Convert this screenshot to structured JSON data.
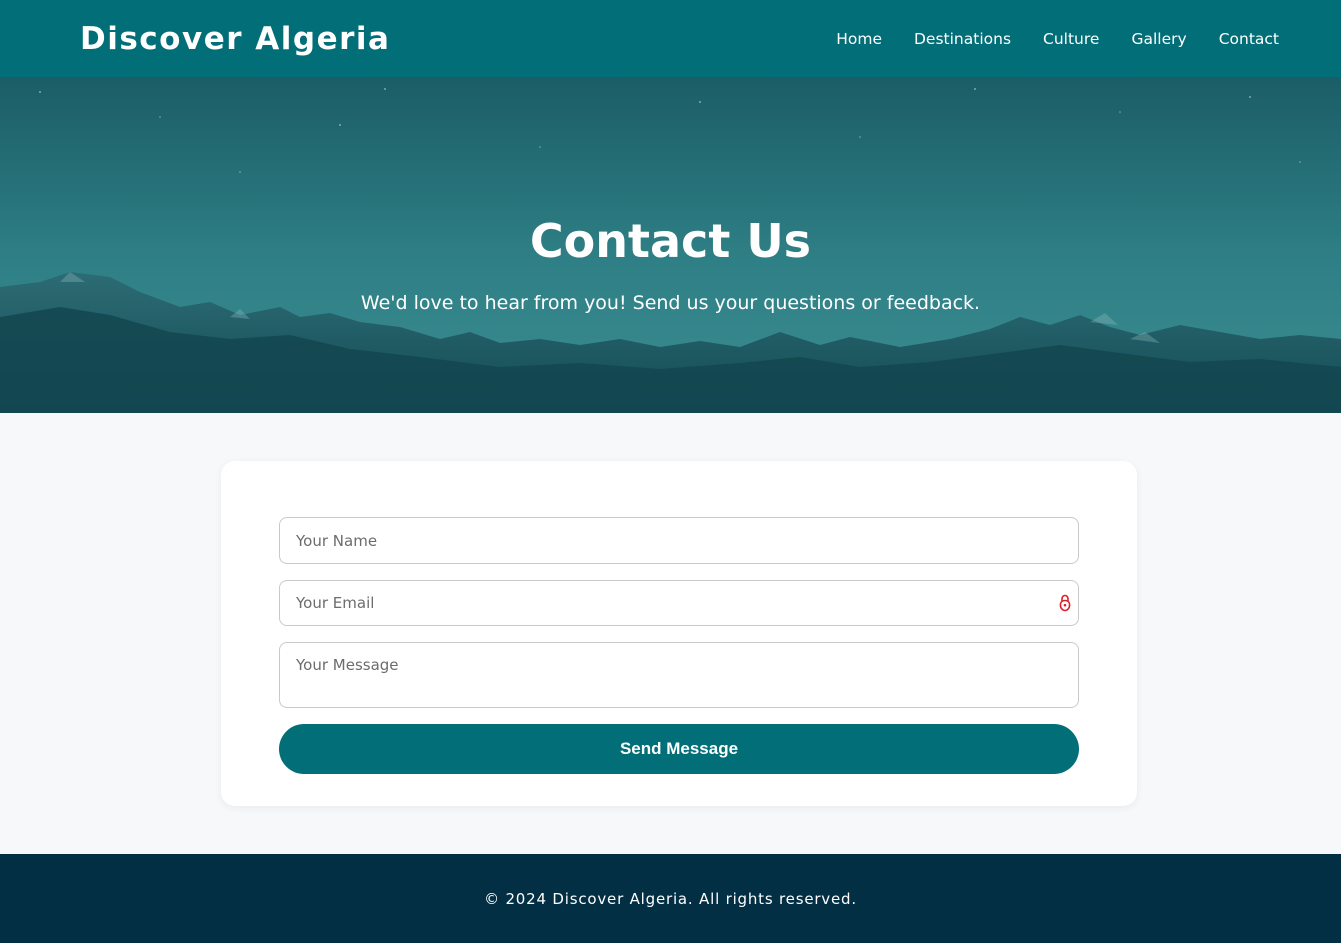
{
  "header": {
    "brand": "Discover Algeria",
    "nav": [
      {
        "label": "Home"
      },
      {
        "label": "Destinations"
      },
      {
        "label": "Culture"
      },
      {
        "label": "Gallery"
      },
      {
        "label": "Contact"
      }
    ]
  },
  "hero": {
    "title": "Contact Us",
    "subtitle": "We'd love to hear from you! Send us your questions or feedback."
  },
  "form": {
    "name_placeholder": "Your Name",
    "email_placeholder": "Your Email",
    "message_placeholder": "Your Message",
    "email_icon": "password-manager-lock-icon",
    "submit_label": "Send Message"
  },
  "footer": {
    "copyright": "© 2024 Discover Algeria. All rights reserved."
  },
  "colors": {
    "primary": "#016e78",
    "footer_bg": "#022f44",
    "page_bg": "#f6f8fa",
    "lock_icon": "#d9212c"
  }
}
